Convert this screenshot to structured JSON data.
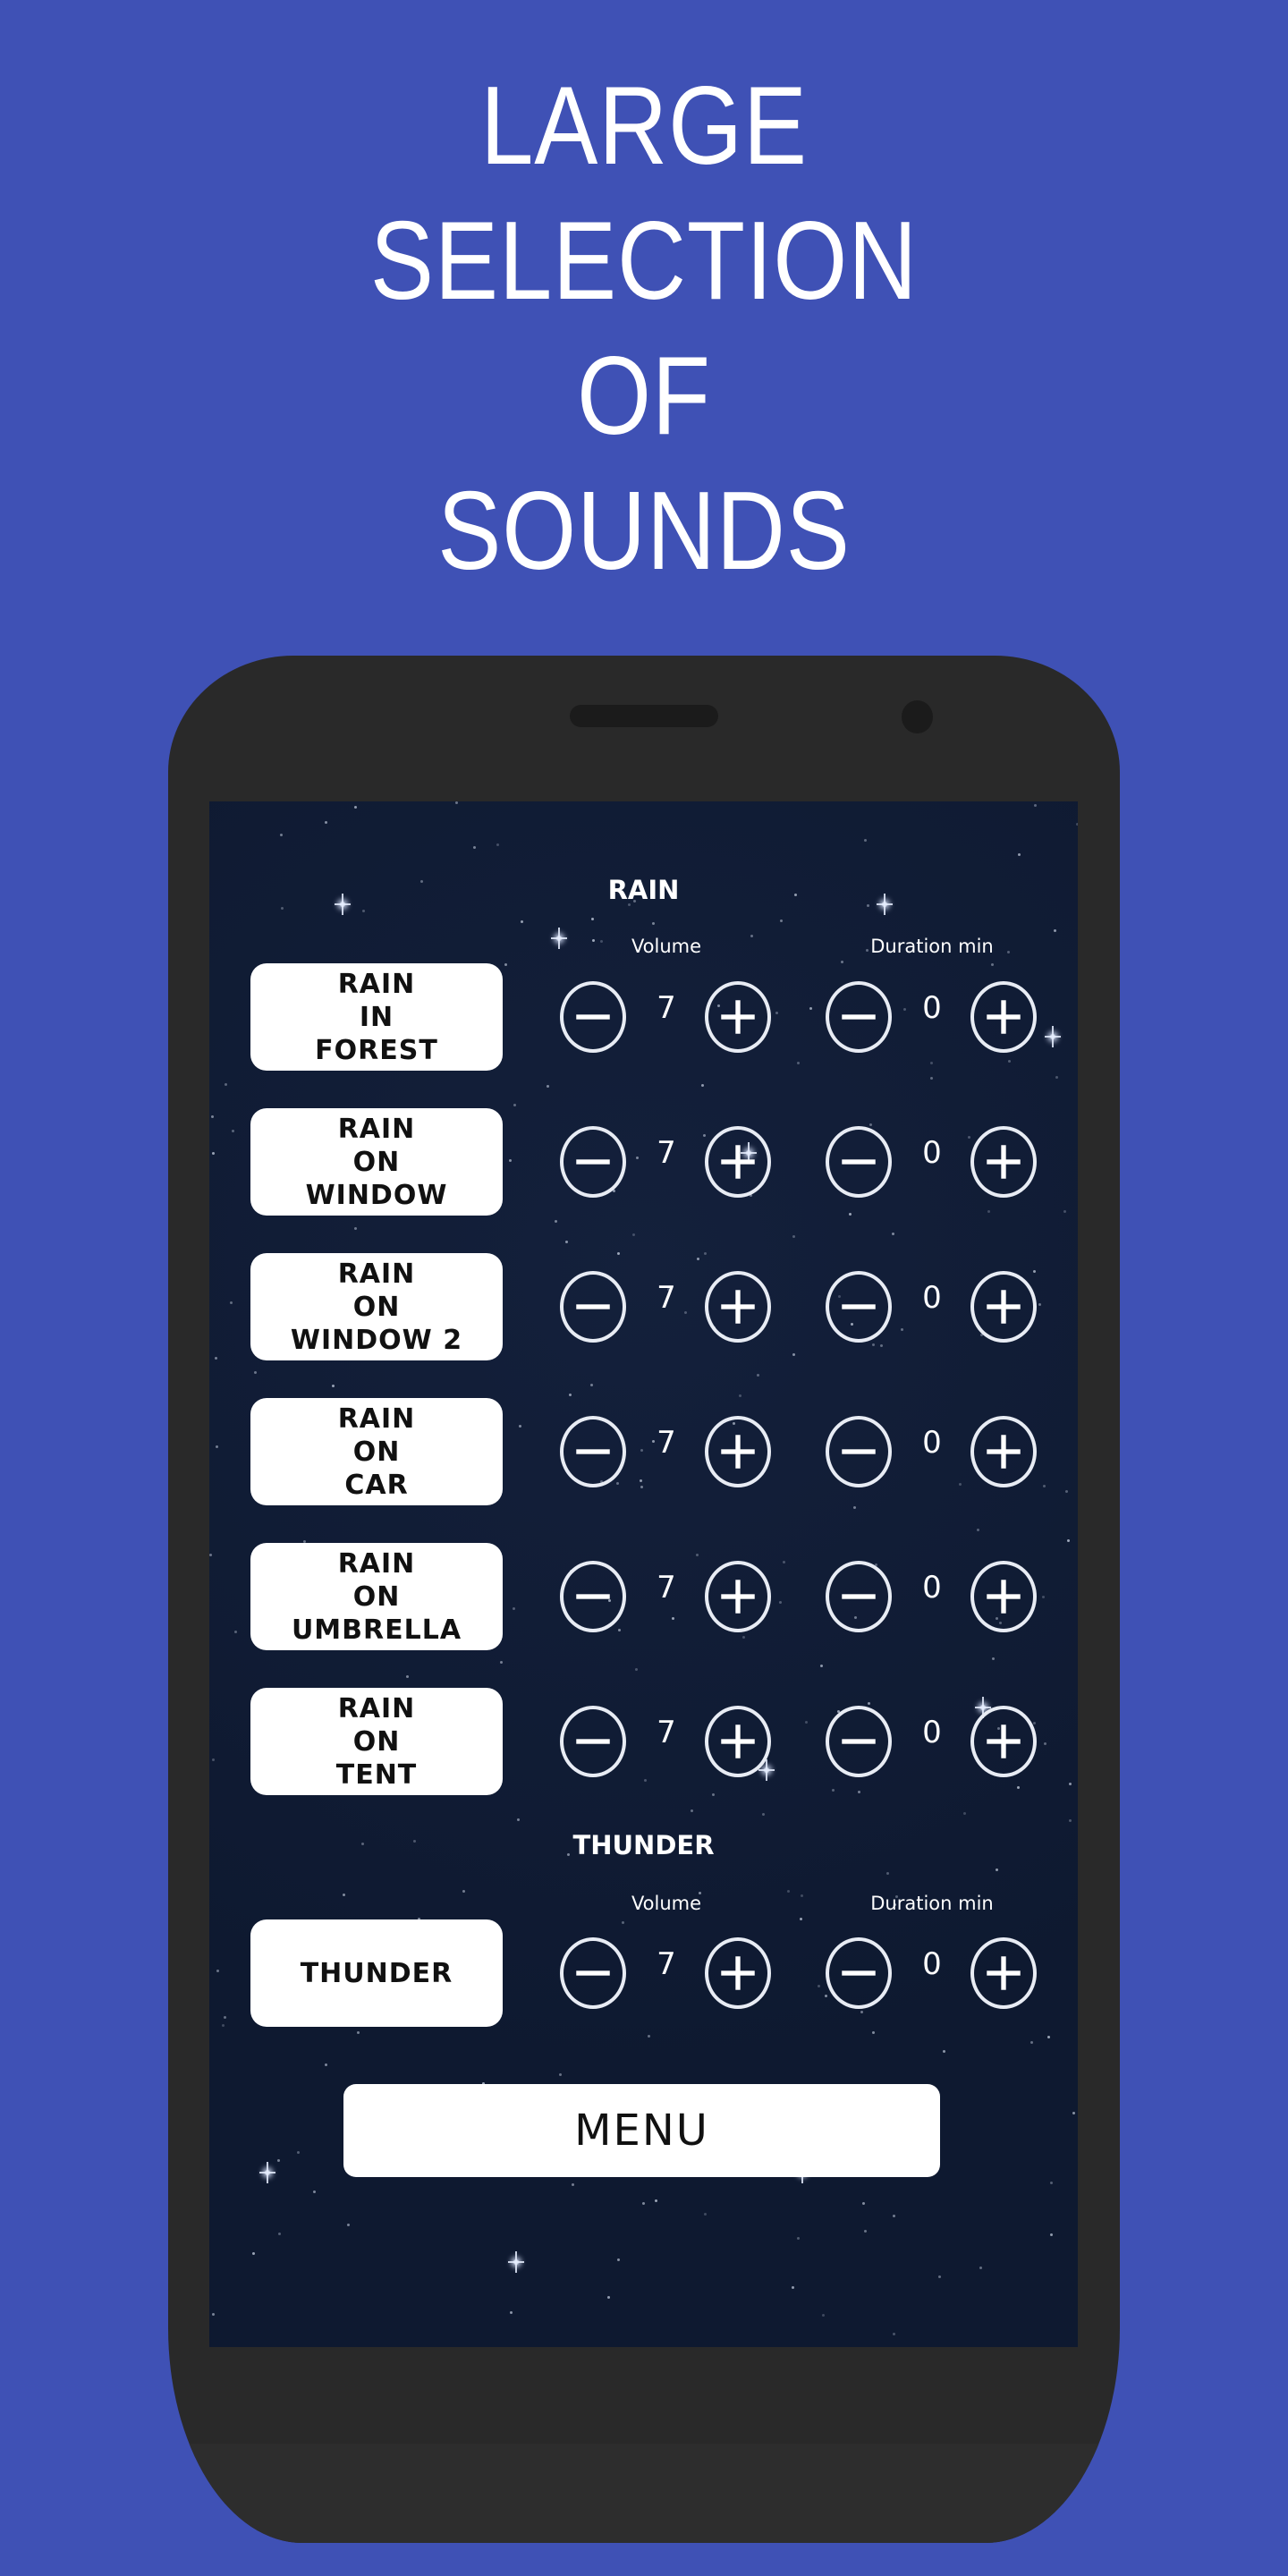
{
  "headline": {
    "lines": [
      "LARGE",
      "SELECTION",
      "OF",
      "SOUNDS"
    ]
  },
  "colors": {
    "background": "#3F51B5",
    "phone_body": "#292929",
    "screen": "#0E1930",
    "button": "#FFFFFF",
    "text_dark": "#111111",
    "text_light": "#FFFFFF"
  },
  "app": {
    "sections": [
      {
        "title": "RAIN",
        "volume_label": "Volume",
        "duration_label": "Duration min",
        "sounds": [
          {
            "label": "RAIN\nIN\nFOREST",
            "volume": "7",
            "duration": "0"
          },
          {
            "label": "RAIN\nON\nWINDOW",
            "volume": "7",
            "duration": "0"
          },
          {
            "label": "RAIN\nON\nWINDOW 2",
            "volume": "7",
            "duration": "0"
          },
          {
            "label": "RAIN\nON\nCAR",
            "volume": "7",
            "duration": "0"
          },
          {
            "label": "RAIN\nON\nUMBRELLA",
            "volume": "7",
            "duration": "0"
          },
          {
            "label": "RAIN\nON\nTENT",
            "volume": "7",
            "duration": "0"
          }
        ]
      },
      {
        "title": "THUNDER",
        "volume_label": "Volume",
        "duration_label": "Duration min",
        "sounds": [
          {
            "label": "THUNDER",
            "volume": "7",
            "duration": "0"
          }
        ]
      }
    ],
    "menu_label": "MENU",
    "icons": {
      "decrease": "minus-circle-icon",
      "increase": "plus-circle-icon"
    }
  }
}
